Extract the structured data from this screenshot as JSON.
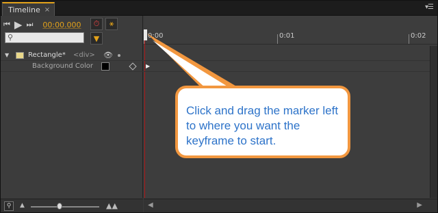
{
  "panel": {
    "tab_title": "Timeline",
    "tab_close": "×",
    "menu_glyph": "▾☰"
  },
  "transport": {
    "go_start_glyph": "⏮",
    "play_glyph": "▶",
    "go_end_glyph": "⏭",
    "timecode": "00:00.000",
    "auto_keyframe_glyph": "⏱",
    "pin_glyph": "⚹"
  },
  "search": {
    "glyph": "⚲",
    "value": ""
  },
  "filter_glyph": "▼",
  "element": {
    "name": "Rectangle*",
    "tag": "<div>",
    "swatch_color": "#e9d88a"
  },
  "property": {
    "label": "Background Color",
    "color": "#000000"
  },
  "ruler": {
    "labels": [
      "0:00",
      "0:01",
      "0:02"
    ]
  },
  "bottom": {
    "zoom_glyph": "🔍",
    "mtn_small_glyph": "▲",
    "mtn_large_glyph": "▲▲",
    "scroll_left_glyph": "◀",
    "scroll_right_glyph": "▶"
  },
  "callout": {
    "text": "Click and drag the marker left to where you want the keyframe to start."
  },
  "colors": {
    "accent": "#e3a21a",
    "callout_border": "#f2973f",
    "callout_text": "#2d73c9",
    "playhead": "#b01818"
  }
}
